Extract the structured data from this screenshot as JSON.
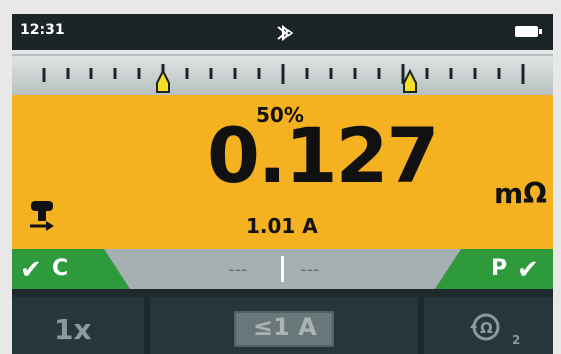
{
  "statusbar": {
    "time": "12:31",
    "center_icon": "bluetooth-icon",
    "battery_icon": "battery-icon"
  },
  "scale": {
    "markers": [
      {
        "name": "lower-limit-marker",
        "value": 0.27
      },
      {
        "name": "upper-limit-marker",
        "value": 0.73
      }
    ]
  },
  "measurement": {
    "percent": "50%",
    "value": "0.127",
    "unit": "mΩ",
    "current": "1.01 A",
    "probe_icon": "probe-connection-icon"
  },
  "status_row": {
    "left_label": "C",
    "right_label": "P",
    "left_dash": "---",
    "right_dash": "---",
    "check_icon": "check-icon"
  },
  "buttons": {
    "repeat": "1x",
    "range": "≤1 A",
    "reverse_icon": "reverse-polarity-icon",
    "reverse_subscript": "2"
  },
  "colors": {
    "accent": "#f4b120",
    "ok": "#2f9a3b",
    "dark": "#1f2a2c"
  }
}
